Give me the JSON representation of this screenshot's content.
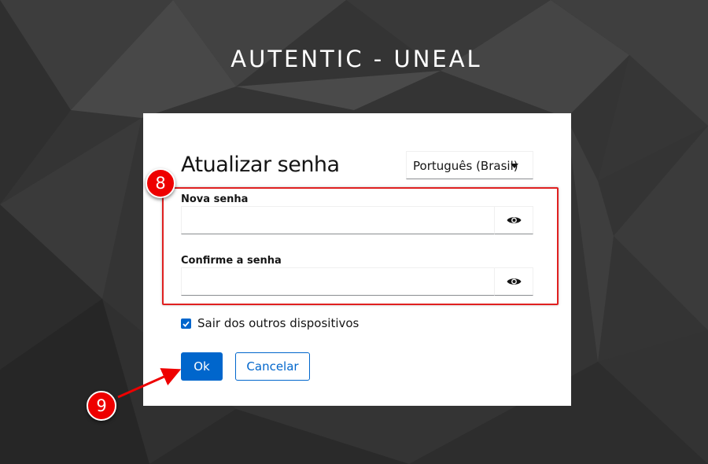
{
  "realm": {
    "title": "AUTENTIC - UNEAL"
  },
  "form": {
    "title": "Atualizar senha",
    "language": {
      "selected": "Português (Brasil)"
    },
    "new_password": {
      "label": "Nova senha",
      "value": ""
    },
    "confirm_password": {
      "label": "Confirme a senha",
      "value": ""
    },
    "logout_others": {
      "label": "Sair dos outros dispositivos",
      "checked": true
    },
    "ok_label": "Ok",
    "cancel_label": "Cancelar"
  },
  "annotations": {
    "step_fields": "8",
    "step_ok": "9",
    "highlight_color": "#e02020"
  },
  "icons": {
    "eye": "eye-icon",
    "caret": "caret-down-icon",
    "check": "check-icon"
  },
  "colors": {
    "primary": "#0066cc",
    "annotation_red": "#ee0000"
  }
}
